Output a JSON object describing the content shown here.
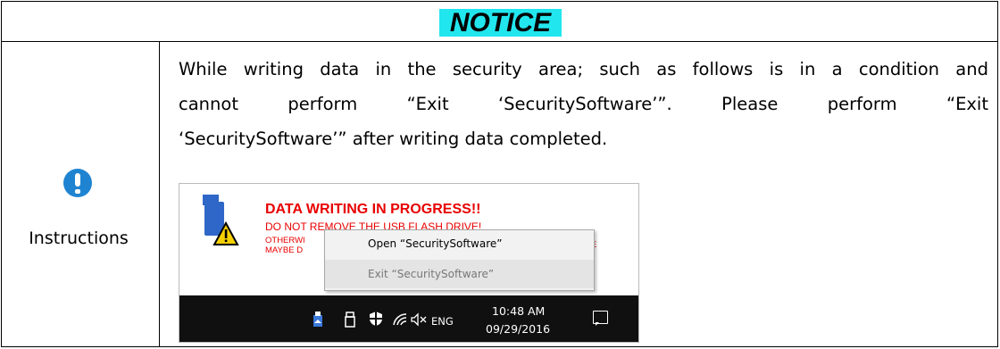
{
  "notice": {
    "title": "NOTICE"
  },
  "instructions": {
    "label": "Instructions"
  },
  "body": {
    "line1": "While writing data in the security area; such as follows is in a condition and",
    "line2": "cannot perform “Exit ‘SecuritySoftware’”. Please perform “Exit",
    "line3": "‘SecuritySoftware’” after writing data completed."
  },
  "screenshot": {
    "banner": {
      "title": "DATA WRITING IN PROGRESS!!",
      "line1": "DO NOT REMOVE THE USB FLASH DRIVE!",
      "line2_visible": "OTHERWI",
      "line2_tail": "DE",
      "line3_visible": "MAYBE D"
    },
    "context_menu": {
      "items": [
        {
          "label": "Open “SecuritySoftware”"
        },
        {
          "label": "Exit “SecuritySoftware”"
        }
      ]
    },
    "taskbar": {
      "language": "ENG",
      "time": "10:48 AM",
      "date": "09/29/2016",
      "icons": [
        "usb-eject-icon",
        "usb-drive-icon",
        "defender-shield-icon",
        "wifi-icon",
        "volume-muted-icon",
        "notification-icon"
      ]
    }
  },
  "colors": {
    "notice_bg": "#22e6ee",
    "instruction_icon": "#1e84d2",
    "banner_text": "#e80000",
    "taskbar": "#101010"
  }
}
